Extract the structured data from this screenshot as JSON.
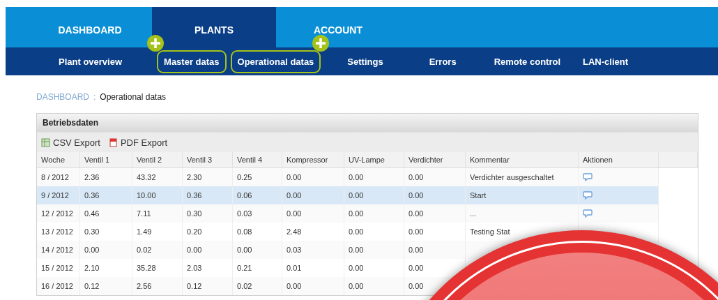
{
  "main_nav": [
    {
      "label": "DASHBOARD",
      "selected": false
    },
    {
      "label": "PLANTS",
      "selected": true
    },
    {
      "label": "ACCOUNT",
      "selected": false
    }
  ],
  "sub_nav": [
    {
      "label": "Plant overview",
      "highlighted": false
    },
    {
      "label": "Master datas",
      "highlighted": true
    },
    {
      "label": "Operational datas",
      "highlighted": true
    },
    {
      "label": "Settings",
      "highlighted": false
    },
    {
      "label": "Errors",
      "highlighted": false
    },
    {
      "label": "Remote control",
      "highlighted": false
    },
    {
      "label": "LAN-client",
      "highlighted": false
    }
  ],
  "breadcrumb": {
    "link": "DASHBOARD",
    "separator": ":",
    "current": "Operational datas"
  },
  "panel": {
    "title": "Betriebsdaten",
    "toolbar": [
      {
        "kind": "csv",
        "label": "CSV Export"
      },
      {
        "kind": "pdf",
        "label": "PDF Export"
      }
    ],
    "columns": [
      "Woche",
      "Ventil 1",
      "Ventil 2",
      "Ventil 3",
      "Ventil 4",
      "Kompressor",
      "UV-Lampe",
      "Verdichter",
      "Kommentar",
      "Aktionen"
    ],
    "rows": [
      {
        "cells": [
          "8 / 2012",
          "2.36",
          "43.32",
          "2.30",
          "0.25",
          "0.00",
          "0.00",
          "0.00",
          "Verdichter ausgeschaltet"
        ],
        "action": true,
        "selected": false
      },
      {
        "cells": [
          "9 / 2012",
          "0.36",
          "10.00",
          "0.36",
          "0.06",
          "0.00",
          "0.00",
          "0.00",
          "Start"
        ],
        "action": true,
        "selected": true
      },
      {
        "cells": [
          "12 / 2012",
          "0.46",
          "7.11",
          "0.30",
          "0.03",
          "0.00",
          "0.00",
          "0.00",
          "..."
        ],
        "action": true,
        "selected": false
      },
      {
        "cells": [
          "13 / 2012",
          "0.30",
          "1.49",
          "0.20",
          "0.08",
          "2.48",
          "0.00",
          "0.00",
          "Testing Stat"
        ],
        "selected": false
      },
      {
        "cells": [
          "14 / 2012",
          "0.00",
          "0.02",
          "0.00",
          "0.00",
          "0.03",
          "0.00",
          "0.00"
        ],
        "selected": false
      },
      {
        "cells": [
          "15 / 2012",
          "2.10",
          "35.28",
          "2.03",
          "0.21",
          "0.01",
          "0.00",
          "0.00"
        ],
        "selected": false
      },
      {
        "cells": [
          "16 / 2012",
          "0.12",
          "2.56",
          "0.12",
          "0.02",
          "0.00",
          "0.00",
          "0.00"
        ],
        "selected": false
      }
    ]
  }
}
